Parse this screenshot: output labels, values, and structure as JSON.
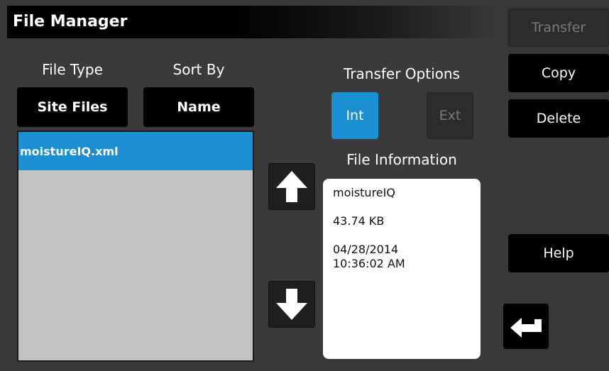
{
  "header": {
    "title": "File Manager"
  },
  "left": {
    "file_type_label": "File Type",
    "sort_by_label": "Sort By",
    "file_type_value": "Site Files",
    "sort_by_value": "Name",
    "files": [
      {
        "name": "moistureIQ.xml",
        "selected": true
      }
    ]
  },
  "transfer_options": {
    "label": "Transfer Options",
    "int_label": "Int",
    "ext_label": "Ext",
    "selected": "Int"
  },
  "file_information": {
    "label": "File Information",
    "name": "moistureIQ",
    "size": "43.74 KB",
    "date": "04/28/2014",
    "time": "10:36:02 AM"
  },
  "right_buttons": {
    "transfer": "Transfer",
    "copy": "Copy",
    "delete": "Delete",
    "help": "Help"
  },
  "icons": {
    "up": "arrow-up-icon",
    "down": "arrow-down-icon",
    "enter": "enter-return-icon"
  },
  "colors": {
    "accent": "#1a8fd1",
    "panel": "#3a3a3a",
    "button": "#000000",
    "list_bg": "#c2c2c2"
  }
}
